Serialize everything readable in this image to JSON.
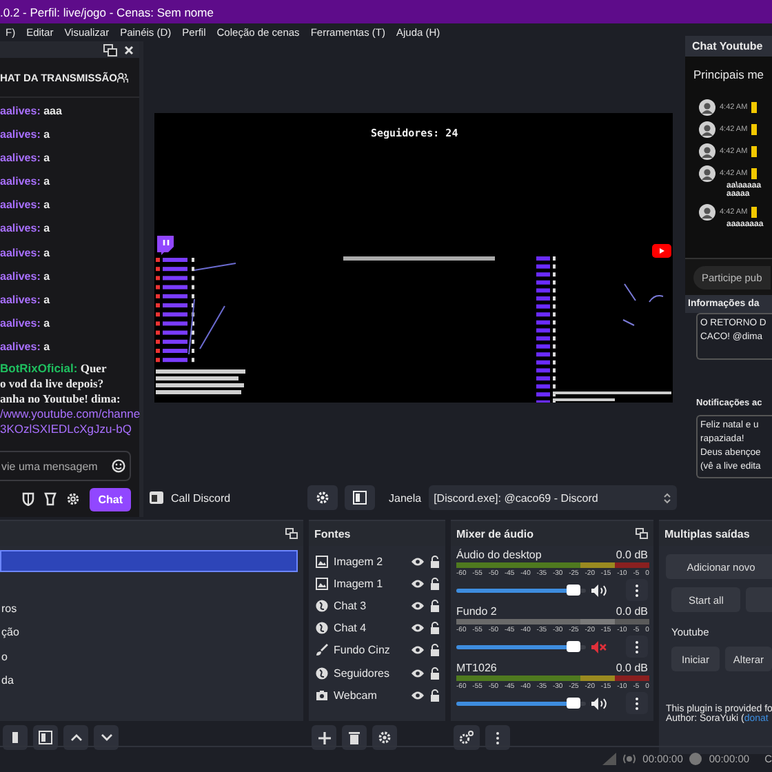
{
  "window": {
    "title": ".0.2 - Perfil: live/jogo - Cenas: Sem nome"
  },
  "menu": [
    "F)",
    "Editar",
    "Visualizar",
    "Painéis (D)",
    "Perfil",
    "Coleção de cenas",
    "Ferramentas (T)",
    "Ajuda (H)"
  ],
  "chat_panel": {
    "title": "HAT DA TRANSMISSÃO",
    "messages": [
      {
        "user": "aalives:",
        "text": "aaa",
        "color": "#a970ff"
      },
      {
        "user": "aalives:",
        "text": "a",
        "color": "#a970ff"
      },
      {
        "user": "aalives:",
        "text": "a",
        "color": "#a970ff"
      },
      {
        "user": "aalives:",
        "text": "a",
        "color": "#a970ff"
      },
      {
        "user": "aalives:",
        "text": "a",
        "color": "#a970ff"
      },
      {
        "user": "aalives:",
        "text": "a",
        "color": "#a970ff"
      },
      {
        "user": "aalives:",
        "text": "a",
        "color": "#a970ff"
      },
      {
        "user": "aalives:",
        "text": "a",
        "color": "#a970ff"
      },
      {
        "user": "aalives:",
        "text": "a",
        "color": "#a970ff"
      },
      {
        "user": "aalives:",
        "text": "a",
        "color": "#a970ff"
      },
      {
        "user": "aalives:",
        "text": "a",
        "color": "#a970ff"
      }
    ],
    "bot_message": {
      "user": "BotRixOficial:",
      "color": "#1fbf5f",
      "lines": [
        "Quer",
        "o vod da live depois?",
        "anha no Youtube! dima:"
      ],
      "link_lines": [
        "/www.youtube.com/channe",
        "3KOzlSXIEDLcXgJzu-bQ"
      ]
    },
    "input": {
      "placeholder": "vie uma mensagem"
    },
    "chat_button": "Chat"
  },
  "preview": {
    "followers": "Seguidores: 24"
  },
  "preview_toolbar": {
    "source": "Call Discord",
    "window_label": "Janela",
    "window_value": "[Discord.exe]: @caco69 - Discord"
  },
  "youtube_chat": {
    "tab": "Chat Youtube",
    "filter": "Principais me",
    "messages": [
      {
        "time": "4:42 AM"
      },
      {
        "time": "4:42 AM"
      },
      {
        "time": "4:42 AM"
      },
      {
        "time": "4:42 AM",
        "lines": [
          "aa\\aaaaa",
          "aaaaa"
        ]
      },
      {
        "time": "4:42 AM",
        "lines": [
          "aaaaaaaa"
        ]
      }
    ],
    "join_button": "Participe pub"
  },
  "info_panel": {
    "title": "Informações da",
    "lines": [
      "O RETORNO D",
      "CACO! @dima"
    ]
  },
  "notifications_panel": {
    "title": "Notificações ac",
    "lines": [
      "Feliz natal e u",
      "rapaziada!",
      "Deus abençoe",
      "(vê a live edita"
    ]
  },
  "scenes": {
    "items": [
      {
        "selected": true
      },
      {
        "selected": false
      },
      {
        "name": "ros",
        "selected": false
      },
      {
        "name": "ção",
        "selected": false
      },
      {
        "name": "o",
        "selected": false
      },
      {
        "name": "da",
        "selected": false
      }
    ]
  },
  "sources": {
    "title": "Fontes",
    "items": [
      {
        "name": "Imagem 2",
        "kind": "image",
        "visible": true
      },
      {
        "name": "Imagem 1",
        "kind": "image",
        "visible": true
      },
      {
        "name": "Chat 3",
        "kind": "browser",
        "visible": true
      },
      {
        "name": "Chat 4",
        "kind": "browser",
        "visible": true
      },
      {
        "name": "Fundo Cinz",
        "kind": "color",
        "visible": true
      },
      {
        "name": "Seguidores",
        "kind": "browser",
        "visible": true
      },
      {
        "name": "Webcam",
        "kind": "camera",
        "visible": true
      }
    ]
  },
  "mixer": {
    "title": "Mixer de áudio",
    "channels": [
      {
        "name": "Áudio do desktop",
        "reading": "0.0 dB",
        "level": 0.93,
        "muted": false,
        "scale": [
          "-60",
          "-55",
          "-50",
          "-45",
          "-40",
          "-35",
          "-30",
          "-25",
          "-20",
          "-15",
          "-10",
          "-5",
          "0"
        ]
      },
      {
        "name": "Fundo 2",
        "reading": "0.0 dB",
        "level": 0.93,
        "muted": true,
        "scale": [
          "-60",
          "-55",
          "-50",
          "-45",
          "-40",
          "-35",
          "-30",
          "-25",
          "-20",
          "-15",
          "-10",
          "-5",
          "0"
        ]
      },
      {
        "name": "MT1026",
        "reading": "0.0 dB",
        "level": 0.93,
        "muted": false,
        "scale": [
          "-60",
          "-55",
          "-50",
          "-45",
          "-40",
          "-35",
          "-30",
          "-25",
          "-20",
          "-15",
          "-10",
          "-5",
          "0"
        ]
      }
    ]
  },
  "outputs": {
    "title": "Multiplas saídas",
    "add_button": "Adicionar novo",
    "start_all": "Start all",
    "targets": [
      {
        "name": "Youtube",
        "buttons": [
          "Iniciar",
          "Alterar"
        ]
      }
    ],
    "footer_text": "This plugin is provided fo",
    "author": "Author: SoraYuki (",
    "author_link": "donat"
  },
  "status_bar": [
    "00:00:00",
    "00:00:00",
    "C"
  ]
}
